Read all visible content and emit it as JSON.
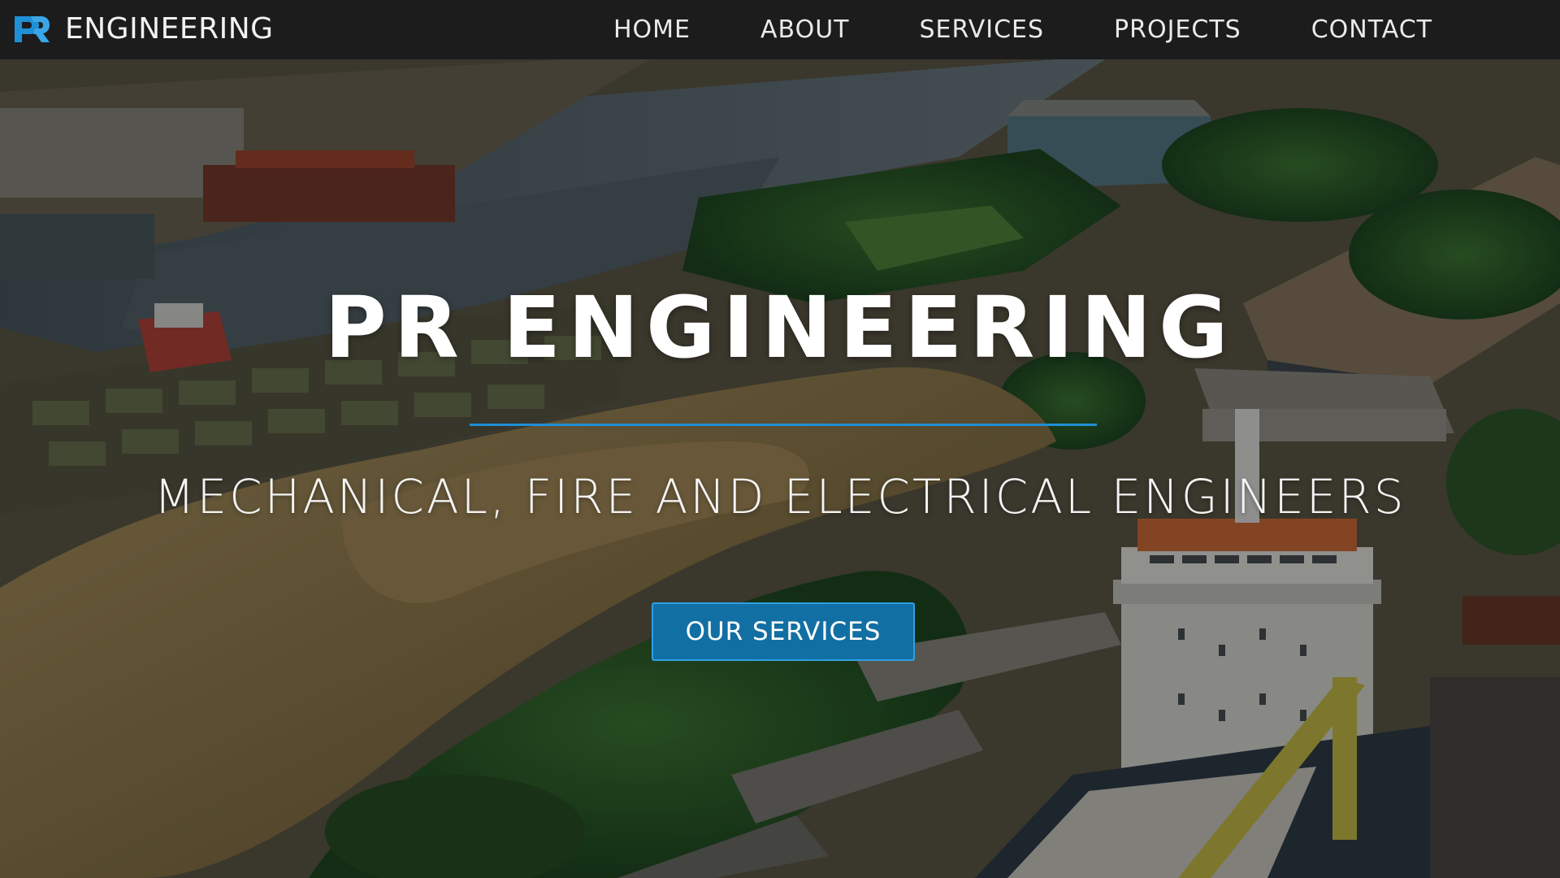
{
  "brand": {
    "logo_icon": "pr-logo-icon",
    "name": "ENGINEERING",
    "accent": "#1f8fd6"
  },
  "nav": {
    "items": [
      {
        "label": "HOME"
      },
      {
        "label": "ABOUT"
      },
      {
        "label": "SERVICES"
      },
      {
        "label": "PROJECTS"
      },
      {
        "label": "CONTACT"
      }
    ]
  },
  "hero": {
    "title": "PR ENGINEERING",
    "subtitle": "MECHANICAL, FIRE AND ELECTRICAL ENGINEERS",
    "cta_label": "OUR SERVICES",
    "background_image": "aerial-port-industrial-photo",
    "divider_color": "#1f8fd6",
    "button_color": "#126fa3"
  }
}
